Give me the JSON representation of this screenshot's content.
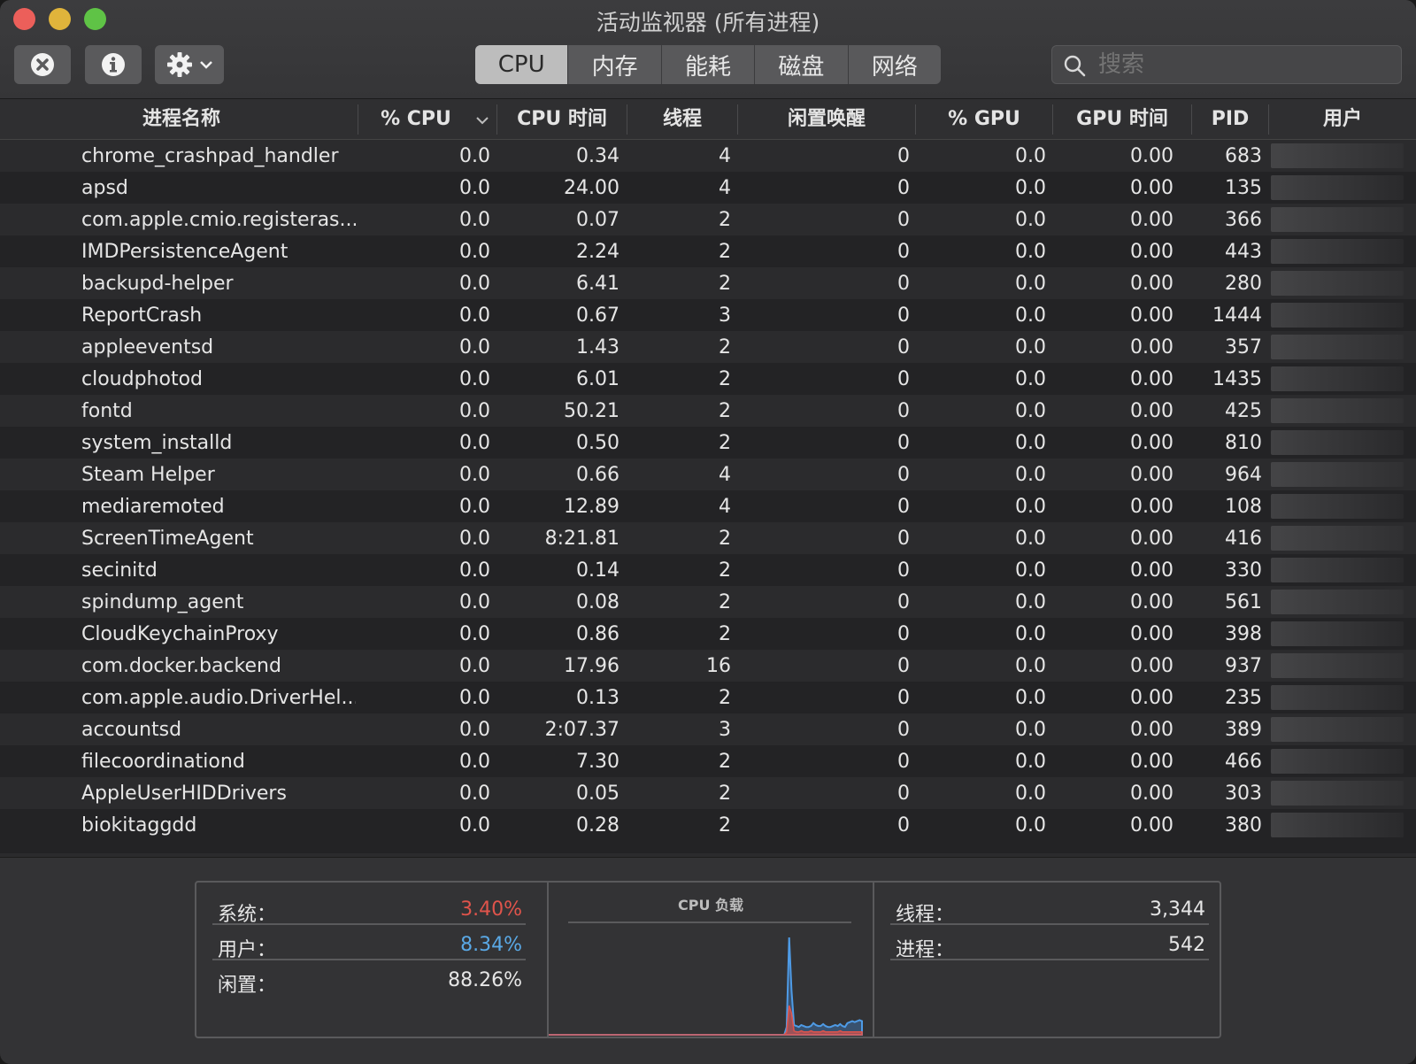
{
  "window": {
    "title": "活动监视器 (所有进程)"
  },
  "toolbar": {
    "tabs": [
      {
        "label": "CPU",
        "active": true
      },
      {
        "label": "内存",
        "active": false
      },
      {
        "label": "能耗",
        "active": false
      },
      {
        "label": "磁盘",
        "active": false
      },
      {
        "label": "网络",
        "active": false
      }
    ],
    "search_placeholder": "搜索",
    "icons": [
      "stop-process-icon",
      "info-icon",
      "gear-icon",
      "chevron-down-icon",
      "search-icon"
    ]
  },
  "table": {
    "headers": [
      "进程名称",
      "% CPU",
      "CPU 时间",
      "线程",
      "闲置唤醒",
      "% GPU",
      "GPU 时间",
      "PID",
      "用户"
    ],
    "sorted_column": "% CPU",
    "rows": [
      [
        "chrome_crashpad_handler",
        "0.0",
        "0.34",
        "4",
        "0",
        "0.0",
        "0.00",
        "683"
      ],
      [
        "apsd",
        "0.0",
        "24.00",
        "4",
        "0",
        "0.0",
        "0.00",
        "135"
      ],
      [
        "com.apple.cmio.registeras...",
        "0.0",
        "0.07",
        "2",
        "0",
        "0.0",
        "0.00",
        "366"
      ],
      [
        "IMDPersistenceAgent",
        "0.0",
        "2.24",
        "2",
        "0",
        "0.0",
        "0.00",
        "443"
      ],
      [
        "backupd-helper",
        "0.0",
        "6.41",
        "2",
        "0",
        "0.0",
        "0.00",
        "280"
      ],
      [
        "ReportCrash",
        "0.0",
        "0.67",
        "3",
        "0",
        "0.0",
        "0.00",
        "1444"
      ],
      [
        "appleeventsd",
        "0.0",
        "1.43",
        "2",
        "0",
        "0.0",
        "0.00",
        "357"
      ],
      [
        "cloudphotod",
        "0.0",
        "6.01",
        "2",
        "0",
        "0.0",
        "0.00",
        "1435"
      ],
      [
        "fontd",
        "0.0",
        "50.21",
        "2",
        "0",
        "0.0",
        "0.00",
        "425"
      ],
      [
        "system_installd",
        "0.0",
        "0.50",
        "2",
        "0",
        "0.0",
        "0.00",
        "810"
      ],
      [
        "Steam Helper",
        "0.0",
        "0.66",
        "4",
        "0",
        "0.0",
        "0.00",
        "964"
      ],
      [
        "mediaremoted",
        "0.0",
        "12.89",
        "4",
        "0",
        "0.0",
        "0.00",
        "108"
      ],
      [
        "ScreenTimeAgent",
        "0.0",
        "8:21.81",
        "2",
        "0",
        "0.0",
        "0.00",
        "416"
      ],
      [
        "secinitd",
        "0.0",
        "0.14",
        "2",
        "0",
        "0.0",
        "0.00",
        "330"
      ],
      [
        "spindump_agent",
        "0.0",
        "0.08",
        "2",
        "0",
        "0.0",
        "0.00",
        "561"
      ],
      [
        "CloudKeychainProxy",
        "0.0",
        "0.86",
        "2",
        "0",
        "0.0",
        "0.00",
        "398"
      ],
      [
        "com.docker.backend",
        "0.0",
        "17.96",
        "16",
        "0",
        "0.0",
        "0.00",
        "937"
      ],
      [
        "com.apple.audio.DriverHel...",
        "0.0",
        "0.13",
        "2",
        "0",
        "0.0",
        "0.00",
        "235"
      ],
      [
        "accountsd",
        "0.0",
        "2:07.37",
        "3",
        "0",
        "0.0",
        "0.00",
        "389"
      ],
      [
        "filecoordinationd",
        "0.0",
        "7.30",
        "2",
        "0",
        "0.0",
        "0.00",
        "466"
      ],
      [
        "AppleUserHIDDrivers",
        "0.0",
        "0.05",
        "2",
        "0",
        "0.0",
        "0.00",
        "303"
      ],
      [
        "biokitaggdd",
        "0.0",
        "0.28",
        "2",
        "0",
        "0.0",
        "0.00",
        "380"
      ]
    ]
  },
  "summary": {
    "system_label": "系统：",
    "system_value": "3.40%",
    "user_label": "用户：",
    "user_value": "8.34%",
    "idle_label": "闲置：",
    "idle_value": "88.26%",
    "chart_title": "CPU 负载",
    "threads_label": "线程：",
    "threads_value": "3,344",
    "processes_label": "进程：",
    "processes_value": "542"
  },
  "chart_data": {
    "type": "area",
    "title": "CPU 负载",
    "series": [
      {
        "values": [
          0,
          0,
          0,
          0,
          0,
          0,
          0,
          0,
          0,
          0,
          0,
          0,
          0,
          0,
          0,
          0,
          0,
          0,
          0,
          0,
          0,
          0,
          0,
          0,
          0,
          0,
          0,
          0,
          0,
          0,
          0,
          0,
          0,
          0,
          0,
          0,
          0,
          0,
          0,
          0,
          0,
          0,
          0,
          0,
          0,
          0,
          0,
          0,
          0,
          0,
          0,
          0,
          0,
          0,
          0,
          0,
          0,
          0,
          0,
          0,
          0,
          0,
          0,
          0,
          0,
          0,
          0,
          0,
          0,
          0,
          0,
          0,
          0,
          0,
          0,
          0,
          0,
          0,
          0,
          0,
          0,
          0,
          0,
          0,
          0,
          0,
          0,
          0,
          0,
          0,
          0,
          0,
          0,
          0,
          0,
          0,
          0,
          0,
          3,
          30,
          22,
          4,
          3,
          3,
          4,
          3,
          3,
          3,
          4,
          3,
          3,
          3,
          3,
          4,
          3,
          3,
          3,
          3,
          3,
          3,
          4,
          3,
          3,
          3,
          3,
          3,
          3,
          3,
          3,
          3
        ]
      },
      {
        "values": [
          0,
          0,
          0,
          0,
          0,
          0,
          0,
          0,
          0,
          0,
          0,
          0,
          0,
          0,
          0,
          0,
          0,
          0,
          0,
          0,
          0,
          0,
          0,
          0,
          0,
          0,
          0,
          0,
          0,
          0,
          0,
          0,
          0,
          0,
          0,
          0,
          0,
          0,
          0,
          0,
          0,
          0,
          0,
          0,
          0,
          0,
          0,
          0,
          0,
          0,
          0,
          0,
          0,
          0,
          0,
          0,
          0,
          0,
          0,
          0,
          0,
          0,
          0,
          0,
          0,
          0,
          0,
          0,
          0,
          0,
          0,
          0,
          0,
          0,
          0,
          0,
          0,
          0,
          0,
          0,
          0,
          0,
          0,
          0,
          0,
          0,
          0,
          0,
          0,
          0,
          0,
          0,
          0,
          0,
          0,
          0,
          0,
          0,
          8,
          100,
          45,
          10,
          9,
          8,
          10,
          9,
          8,
          8,
          9,
          12,
          10,
          9,
          9,
          11,
          9,
          8,
          8,
          9,
          10,
          9,
          11,
          9,
          8,
          12,
          13,
          14,
          13,
          14,
          15,
          14
        ]
      }
    ]
  }
}
